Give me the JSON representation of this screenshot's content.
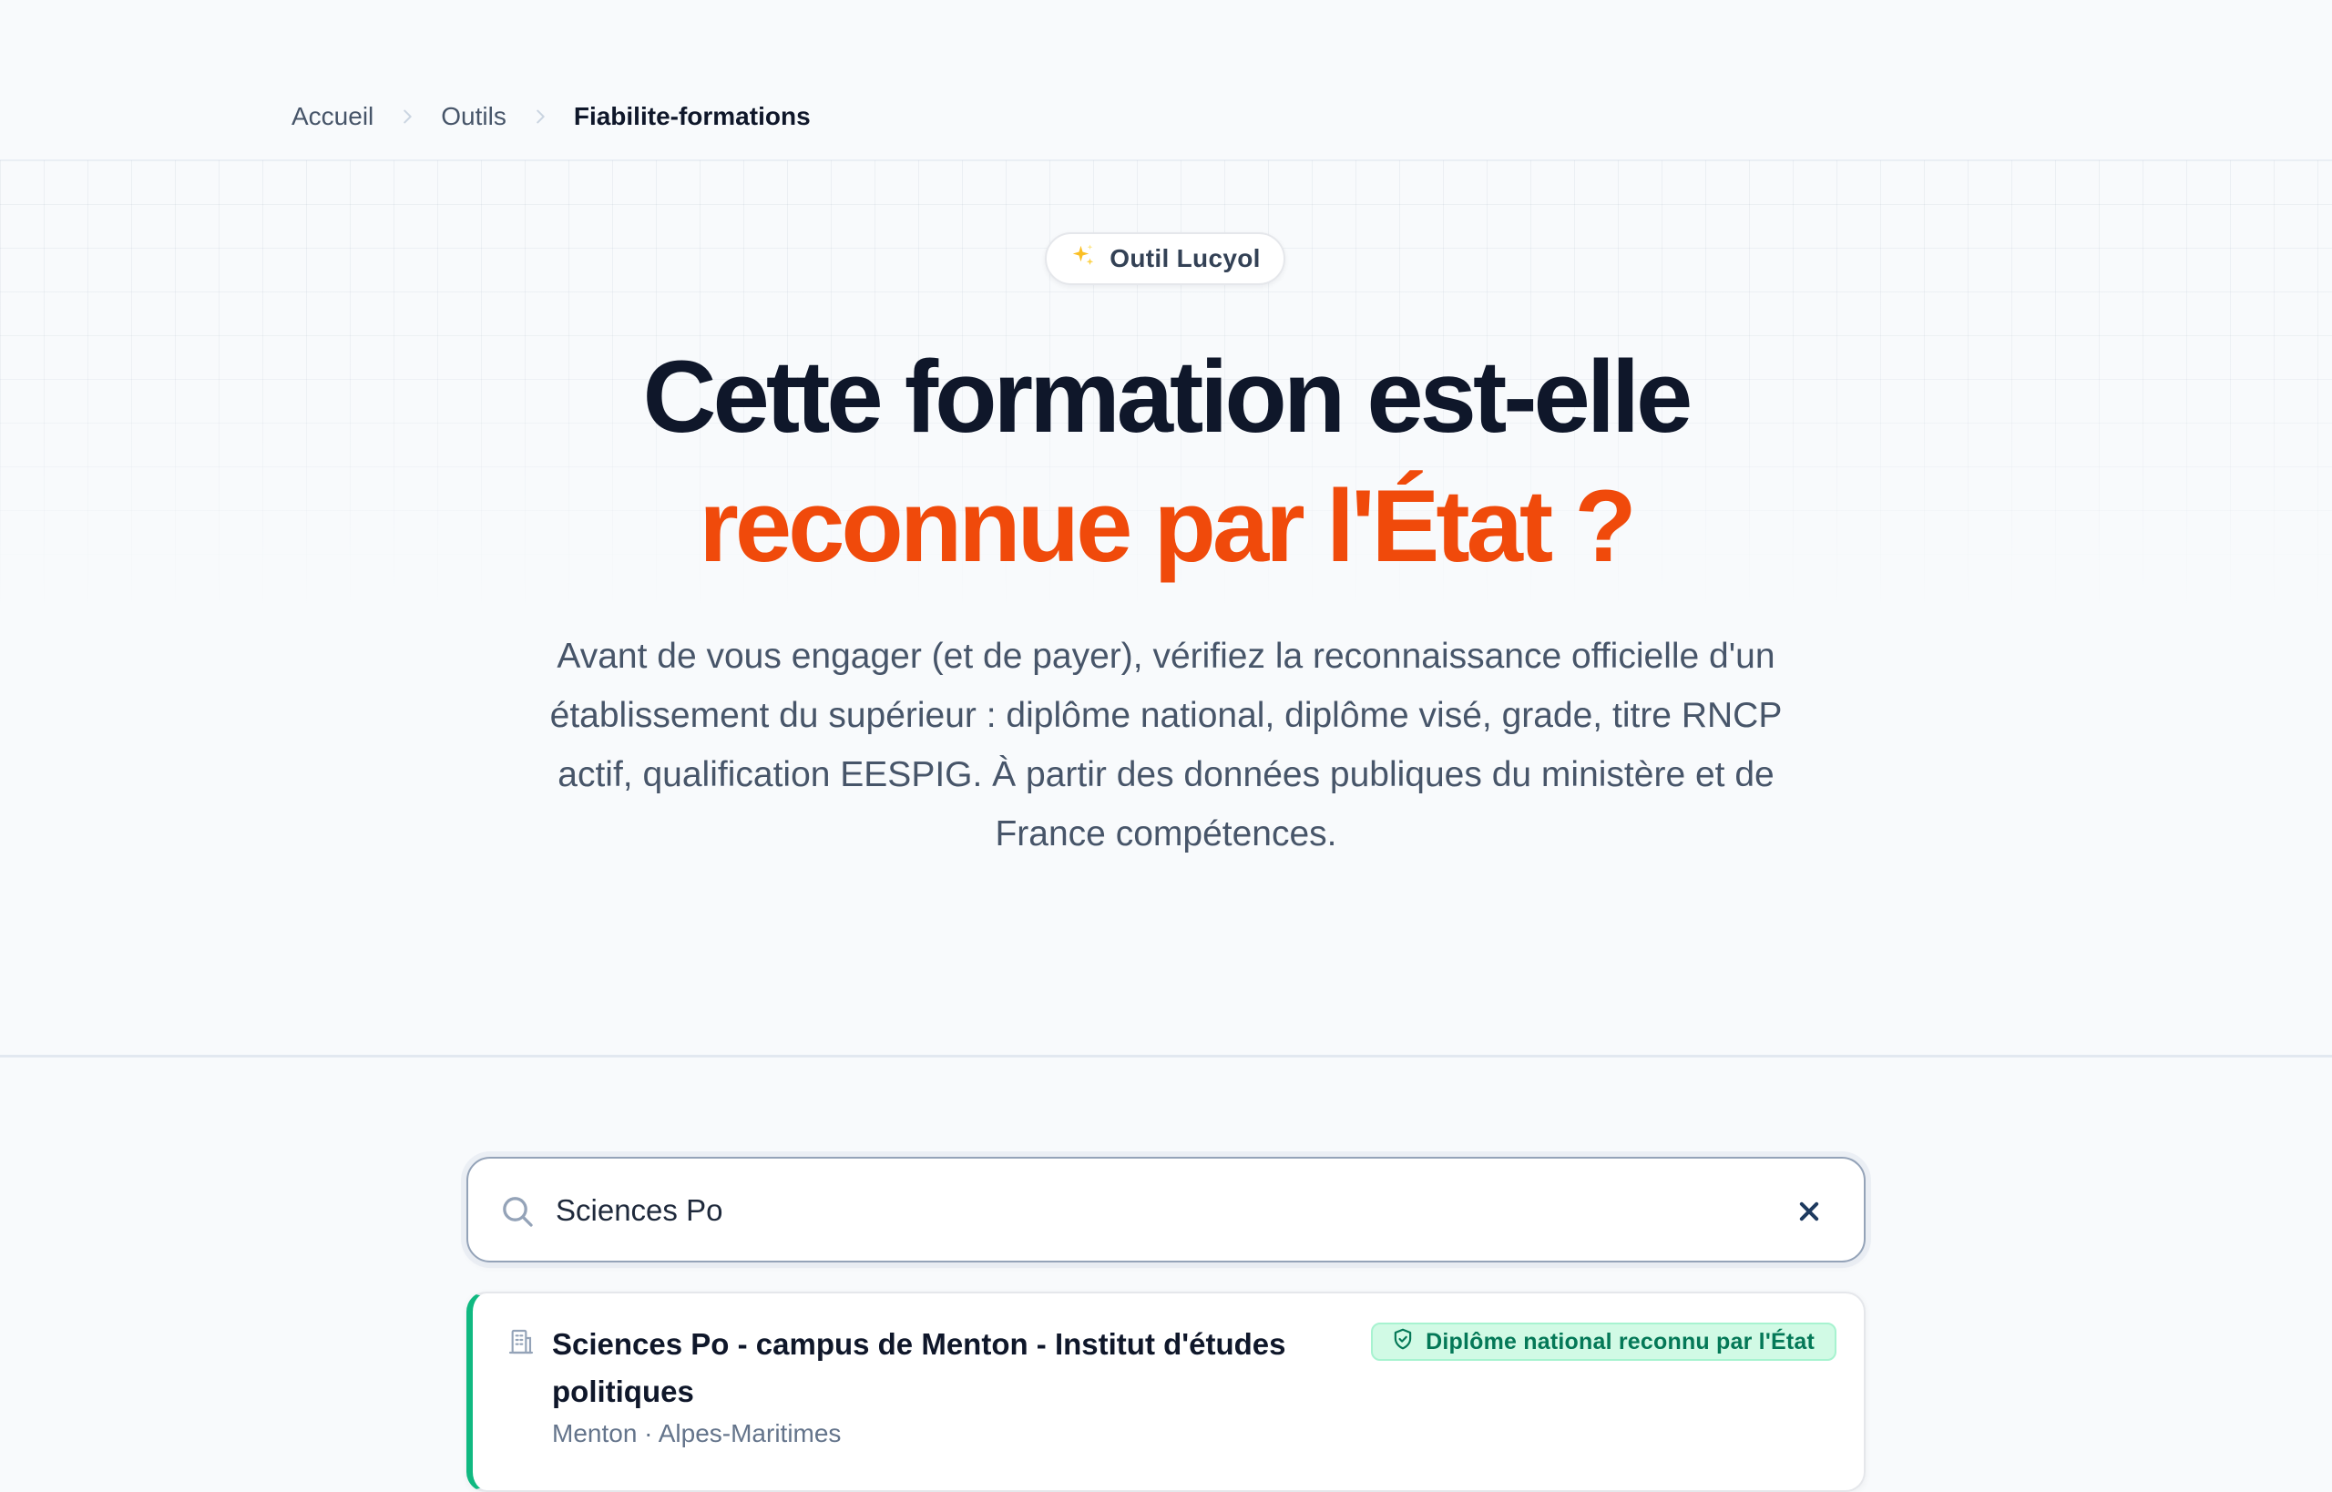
{
  "breadcrumb": {
    "items": [
      {
        "label": "Accueil"
      },
      {
        "label": "Outils"
      },
      {
        "label": "Fiabilite-formations"
      }
    ]
  },
  "hero": {
    "badge_label": "Outil Lucyol",
    "title_line1": "Cette formation est-elle",
    "title_line2": "reconnue par l'État ?",
    "subtitle": "Avant de vous engager (et de payer), vérifiez la reconnaissance officielle d'un établissement du supérieur : diplôme national, diplôme visé, grade, titre RNCP actif, qualification EESPIG. À partir des données publiques du ministère et de France compétences."
  },
  "search": {
    "value": "Sciences Po",
    "placeholder": ""
  },
  "results": [
    {
      "name": "Sciences Po - campus de Menton - Institut d'études politiques",
      "location": "Menton · Alpes-Maritimes",
      "status_label": "Diplôme national reconnu par l'État",
      "accent_color": "#10b981"
    }
  ],
  "icons": {
    "badge": "sparkles-icon",
    "search": "search-icon",
    "clear": "close-icon",
    "result": "building-icon",
    "status": "shield-check-icon"
  },
  "colors": {
    "accent": "#f04a0b",
    "success": "#10b981",
    "text": "#0f172a"
  }
}
